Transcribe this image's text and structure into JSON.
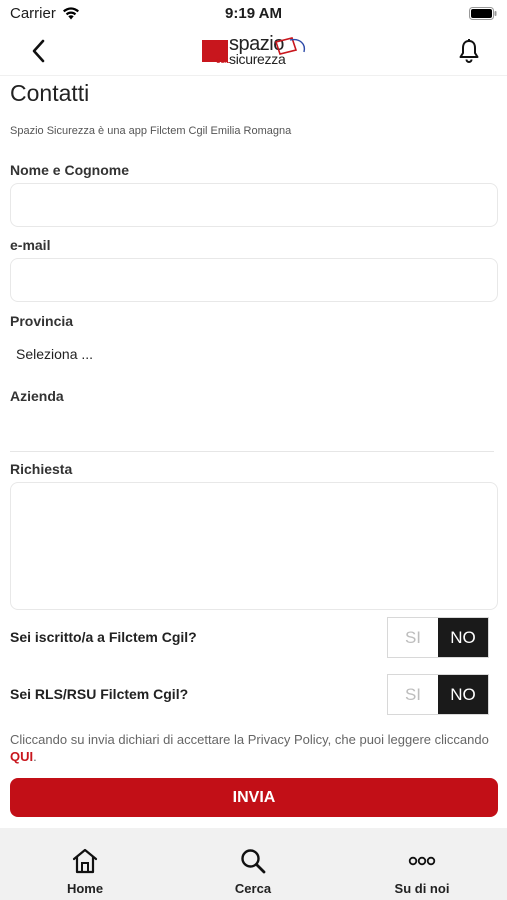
{
  "status_bar": {
    "carrier": "Carrier",
    "time": "9:19 AM"
  },
  "nav": {
    "logo_word1": "spazio",
    "logo_word2": "sicurezza",
    "logo_badge": "CGIL",
    "brand_color": "#c8161d"
  },
  "page": {
    "title": "Contatti",
    "subtitle": "Spazio Sicurezza è una app Filctem Cgil Emilia Romagna"
  },
  "form": {
    "name_label": "Nome e Cognome",
    "name_value": "",
    "email_label": "e-mail",
    "email_value": "",
    "province_label": "Provincia",
    "province_value": "Seleziona ...",
    "company_label": "Azienda",
    "company_value": "",
    "request_label": "Richiesta",
    "request_value": "",
    "q1_label": "Sei iscritto/a a Filctem Cgil?",
    "q1_options": [
      "SI",
      "NO"
    ],
    "q1_selected": "NO",
    "q2_label": "Sei RLS/RSU Filctem Cgil?",
    "q2_options": [
      "SI",
      "NO"
    ],
    "q2_selected": "NO",
    "privacy_text": "Cliccando su invia dichiari di accettare la Privacy Policy, che puoi leggere cliccando ",
    "privacy_link": "QUI",
    "privacy_end": ".",
    "submit_label": "INVIA"
  },
  "tabs": [
    {
      "label": "Home",
      "icon": "home-icon"
    },
    {
      "label": "Cerca",
      "icon": "search-icon"
    },
    {
      "label": "Su di noi",
      "icon": "more-icon"
    }
  ]
}
